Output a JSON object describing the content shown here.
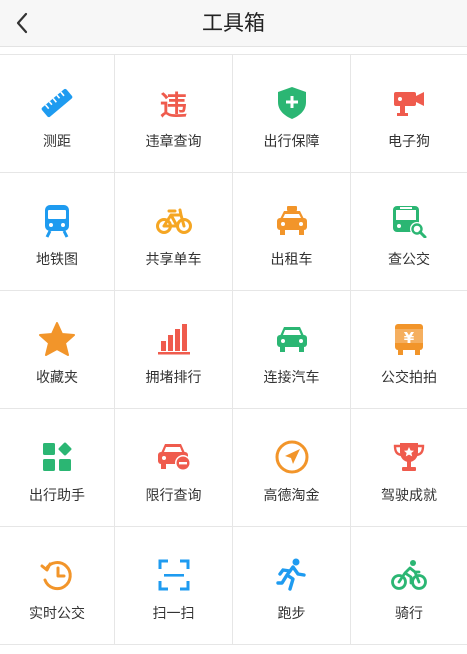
{
  "header": {
    "title": "工具箱",
    "back_icon": "chevron-left-icon"
  },
  "colors": {
    "red": "#ef5b4d",
    "blue": "#1e9bf0",
    "green": "#2bb673",
    "orange": "#f5a623",
    "gold": "#f2952a"
  },
  "tools": [
    {
      "label": "测距",
      "icon": "ruler-icon"
    },
    {
      "label": "违章查询",
      "icon": "violation-icon",
      "icon_text": "违"
    },
    {
      "label": "出行保障",
      "icon": "shield-plus-icon"
    },
    {
      "label": "电子狗",
      "icon": "camera-icon"
    },
    {
      "label": "地铁图",
      "icon": "subway-icon"
    },
    {
      "label": "共享单车",
      "icon": "bicycle-icon"
    },
    {
      "label": "出租车",
      "icon": "taxi-icon"
    },
    {
      "label": "查公交",
      "icon": "bus-search-icon"
    },
    {
      "label": "收藏夹",
      "icon": "star-icon"
    },
    {
      "label": "拥堵排行",
      "icon": "bar-chart-icon"
    },
    {
      "label": "连接汽车",
      "icon": "car-icon"
    },
    {
      "label": "公交拍拍",
      "icon": "bus-yen-icon",
      "icon_text": "¥"
    },
    {
      "label": "出行助手",
      "icon": "grid-tiles-icon"
    },
    {
      "label": "限行查询",
      "icon": "car-minus-icon"
    },
    {
      "label": "高德淘金",
      "icon": "compass-plane-icon"
    },
    {
      "label": "驾驶成就",
      "icon": "trophy-icon"
    },
    {
      "label": "实时公交",
      "icon": "clock-refresh-icon"
    },
    {
      "label": "扫一扫",
      "icon": "scan-icon"
    },
    {
      "label": "跑步",
      "icon": "running-icon"
    },
    {
      "label": "骑行",
      "icon": "cycling-icon"
    }
  ]
}
